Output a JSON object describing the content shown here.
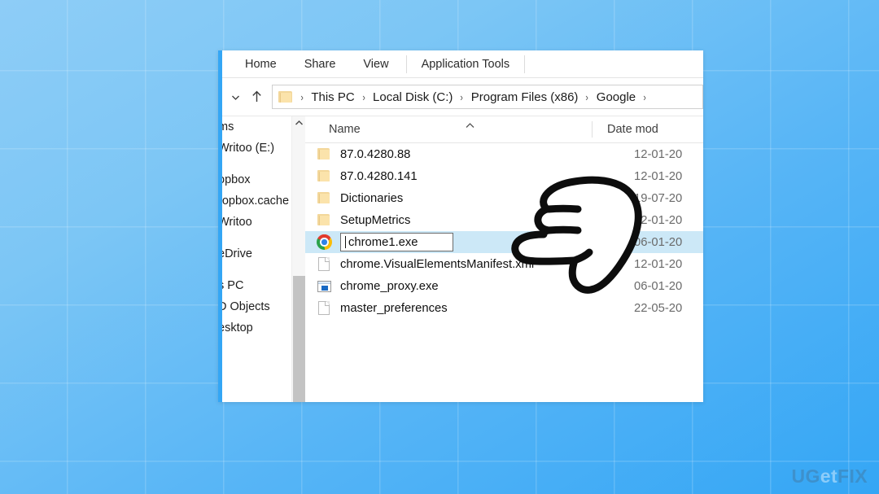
{
  "watermark": {
    "prefix": "UG",
    "accent": "et",
    "suffix": "FIX"
  },
  "window": {
    "ribbon_tabs": [
      {
        "label": "Home",
        "name": "tab-home"
      },
      {
        "label": "Share",
        "name": "tab-share"
      },
      {
        "label": "View",
        "name": "tab-view"
      }
    ],
    "contextual_tab": {
      "label": "Application Tools",
      "name": "tab-application-tools"
    },
    "address_bar": {
      "back_dropdown_icon": "chevron-down-icon",
      "up_icon": "arrow-up-icon",
      "folder_icon": "folder-icon",
      "crumbs": [
        "This PC",
        "Local Disk (C:)",
        "Program Files (x86)",
        "Google"
      ],
      "separator": "›",
      "trailing_truncated": true
    },
    "nav_pane": {
      "items": [
        {
          "label": "ms",
          "truncated": true
        },
        {
          "label": "Writoo (E:)",
          "truncated": true
        },
        {
          "label": "opbox",
          "truncated": true,
          "gap_before": true
        },
        {
          "label": "ropbox.cache",
          "truncated": true
        },
        {
          "label": "Writoo",
          "truncated": true
        },
        {
          "label": "eDrive",
          "truncated": true,
          "gap_before": true
        },
        {
          "label": "s PC",
          "truncated": true,
          "gap_before": true
        },
        {
          "label": "D Objects",
          "truncated": true
        },
        {
          "label": "esktop",
          "truncated": true
        }
      ],
      "scroll_up_icon": "chevron-up-icon"
    },
    "file_list": {
      "columns": [
        {
          "label": "Name",
          "name": "column-header-name",
          "sort_icon": "sort-ascending-icon"
        },
        {
          "label": "Date mod",
          "name": "column-header-date-modified",
          "truncated": true
        }
      ],
      "rows": [
        {
          "name": "87.0.4280.88",
          "icon": "folder-icon",
          "date": "12-01-20",
          "type": "folder",
          "selected": false
        },
        {
          "name": "87.0.4280.141",
          "icon": "folder-icon",
          "date": "12-01-20",
          "type": "folder",
          "selected": false
        },
        {
          "name": "Dictionaries",
          "icon": "folder-icon",
          "date": "19-07-20",
          "type": "folder",
          "selected": false
        },
        {
          "name": "SetupMetrics",
          "icon": "folder-icon",
          "date": "12-01-20",
          "type": "folder",
          "selected": false
        },
        {
          "name": "chrome1.exe",
          "icon": "chrome-logo-icon",
          "date": "06-01-20",
          "type": "executable",
          "selected": true,
          "renaming": true
        },
        {
          "name": "chrome.VisualElementsManifest.xml",
          "icon": "document-icon",
          "date": "12-01-20",
          "type": "xml",
          "selected": false
        },
        {
          "name": "chrome_proxy.exe",
          "icon": "application-icon",
          "date": "06-01-20",
          "type": "executable",
          "selected": false
        },
        {
          "name": "master_preferences",
          "icon": "document-icon",
          "date": "22-05-20",
          "type": "file",
          "selected": false
        }
      ],
      "rename_field": {
        "value": "chrome1.exe",
        "caret_visible": true
      }
    },
    "annotation": {
      "icon": "pointing-hand-icon",
      "points_at": "chrome1.exe"
    }
  },
  "colors": {
    "backdrop_light": "#8ecdf7",
    "backdrop_dark": "#34a6f5",
    "selection": "#cce8f7",
    "window_bg": "#ffffff"
  }
}
